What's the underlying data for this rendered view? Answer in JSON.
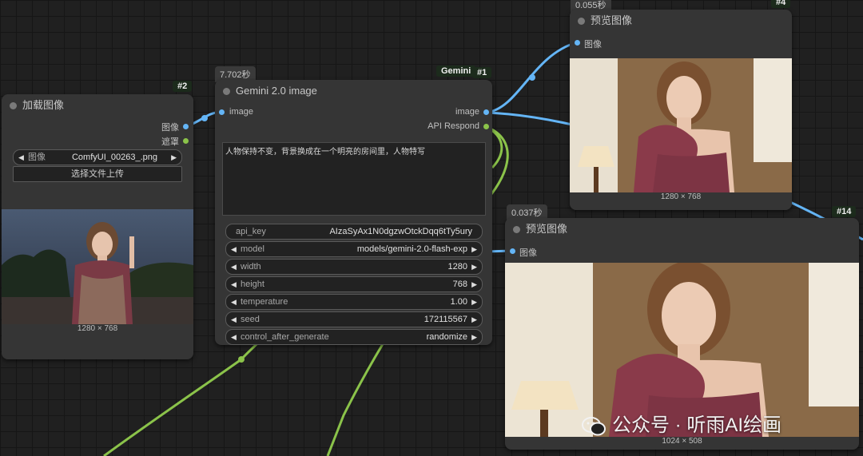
{
  "nodes": {
    "load": {
      "id": "#2",
      "title": "加载图像",
      "outputs": [
        "图像",
        "遮罩"
      ],
      "image_widget": {
        "label": "图像",
        "value": "ComfyUI_00263_.png"
      },
      "upload_button": "选择文件上传",
      "size": "1280 × 768"
    },
    "gemini": {
      "id": "#1",
      "title": "Gemini 2.0 image",
      "time": "7.702秒",
      "tag": "Gemini",
      "input": "image",
      "outputs": [
        "image",
        "API Respond"
      ],
      "prompt": "人物保持不变，背景换成在一个明亮的房间里，人物特写",
      "widgets": [
        {
          "label": "api_key",
          "value": "AIzaSyAx1N0dgzwOtckDqq6tTy5ury",
          "arrows": false
        },
        {
          "label": "model",
          "value": "models/gemini-2.0-flash-exp",
          "arrows": true
        },
        {
          "label": "width",
          "value": "1280",
          "arrows": true
        },
        {
          "label": "height",
          "value": "768",
          "arrows": true
        },
        {
          "label": "temperature",
          "value": "1.00",
          "arrows": true
        },
        {
          "label": "seed",
          "value": "172115567",
          "arrows": true
        },
        {
          "label": "control_after_generate",
          "value": "randomize",
          "arrows": true
        }
      ]
    },
    "preview4": {
      "id": "#4",
      "title": "预览图像",
      "time": "0.055秒",
      "input": "图像",
      "size": "1280 × 768"
    },
    "preview14": {
      "id": "#14",
      "title": "预览图像",
      "time": "0.037秒",
      "input": "图像",
      "size": "1024 × 508"
    }
  },
  "watermark": "公众号 · 听雨AI绘画",
  "colors": {
    "image_wire": "#64b5f6",
    "text_wire": "#8bc34a",
    "node_bg": "#353535"
  },
  "icons": [
    "wechat-icon"
  ]
}
